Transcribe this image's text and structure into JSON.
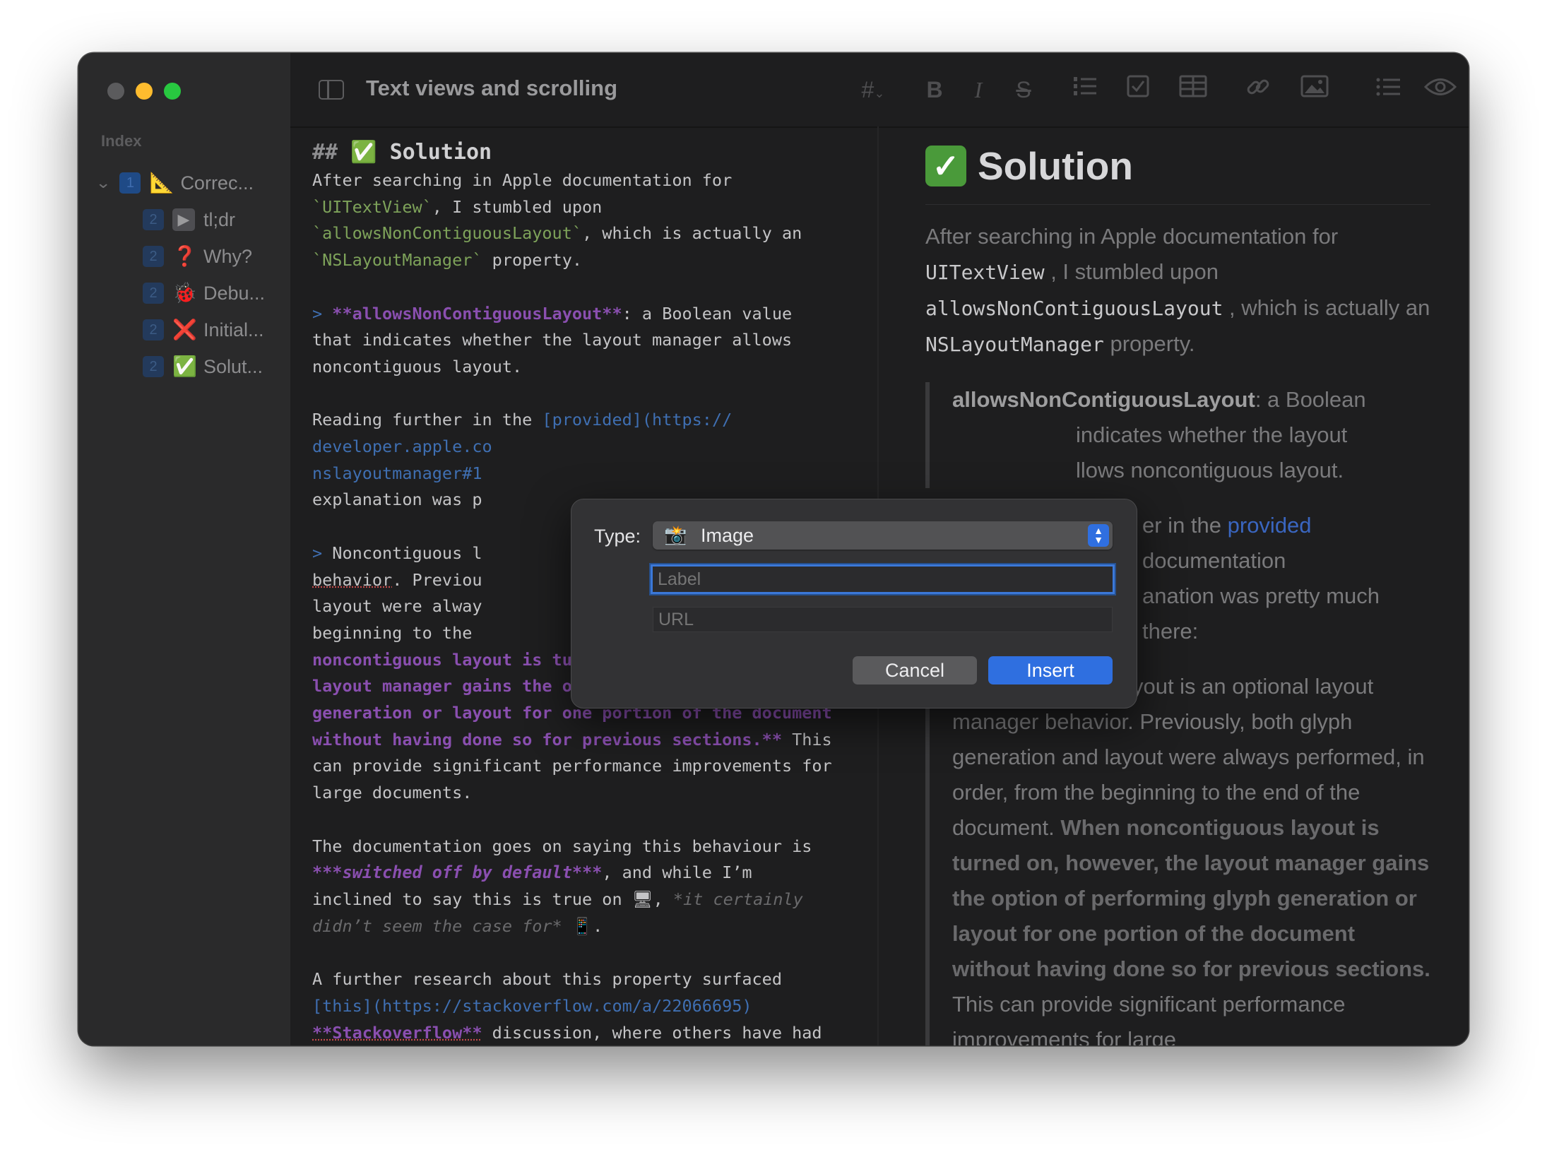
{
  "window": {
    "title": "Text views and scrolling"
  },
  "sidebar": {
    "index_label": "Index",
    "items": [
      {
        "level": "1",
        "icon": "triangle-ruler-icon",
        "glyph": "📐",
        "label": "Correc..."
      },
      {
        "level": "2",
        "icon": "play-icon",
        "glyph": "▶",
        "label": "tl;dr"
      },
      {
        "level": "2",
        "icon": "question-icon",
        "glyph": "❓",
        "label": "Why?"
      },
      {
        "level": "2",
        "icon": "bug-icon",
        "glyph": "🐞",
        "label": "Debu..."
      },
      {
        "level": "2",
        "icon": "cross-mark-icon",
        "glyph": "❌",
        "label": "Initial..."
      },
      {
        "level": "2",
        "icon": "check-mark-icon",
        "glyph": "✅",
        "label": "Solut..."
      }
    ]
  },
  "toolbar": {
    "heading": "#",
    "bold": "B",
    "italic": "I",
    "strike": "S"
  },
  "editor": {
    "heading_marker": "## ",
    "heading_check": "✅",
    "heading_text": " Solution",
    "p1_a": "After searching in Apple documentation for\n",
    "p1_code1": "`UITextView`",
    "p1_b": ", I stumbled upon\n",
    "p1_code2": "`allowsNonContiguousLayout`",
    "p1_c": ", which is actually an\n",
    "p1_code3": "`NSLayoutManager`",
    "p1_d": " property.",
    "q1_marker": "> ",
    "q1_bold": "**allowsNonContiguousLayout**",
    "q1_rest": ": a Boolean value\nthat indicates whether the layout manager allows\nnoncontiguous layout.",
    "p2_a": "Reading further in the ",
    "p2_link": "[provided](https://\ndeveloper.apple.co",
    "p2_link2": "nslayoutmanager#1",
    "p2_b": "explanation was p",
    "q2_marker": "> ",
    "q2_a": "Noncontiguous l",
    "q2_spell": "behavior",
    "q2_b": ". Previou\nlayout were alway\nbeginning to the",
    "q2_bold": "noncontiguous layout is turned on, however, the\nlayout manager gains the option of performing glyph\ngeneration or layout for one portion of the document\nwithout having done so for previous sections.**",
    "q2_c": " This\ncan provide significant performance improvements for\nlarge documents.",
    "p3_a": "The documentation goes on saying this behaviour is\n",
    "p3_em": "***switched off by default***",
    "p3_b": ", and while I’m\ninclined to say this is true on ",
    "p3_mac": "🖥",
    "p3_c": ", ",
    "p3_it": "*it certainly\ndidn’t seem the case for*",
    "p3_phone": " 📱",
    "p3_d": ".",
    "p4_a": "A further research about this property surfaced\n",
    "p4_link": "[this](https://stackoverflow.com/a/22066695)",
    "p4_bold": "**Stackoverflow**",
    "p4_b": " discussion, where others have had"
  },
  "preview": {
    "heading_check": "✓",
    "heading": "Solution",
    "p1_a": "After searching in Apple documentation for ",
    "p1_code1": "UITextView",
    "p1_b": " , I stumbled upon ",
    "p1_code2": "allowsNonContiguousLayout",
    "p1_c": " , which is actually an ",
    "p1_code3": "NSLayoutManager",
    "p1_d": "  property.",
    "q1_bold": "allowsNonContiguousLayout",
    "q1_a": ": a Boolean",
    "q1_b": "indicates whether the layout",
    "q1_c": "llows noncontiguous layout.",
    "p2_a": "er in the ",
    "p2_link": "provided",
    "p2_b": " documentation",
    "p2_c": "anation was pretty much there:",
    "q2_a": "uous layout is an optional layout manager behavior. Previously, both glyph generation and layout were always performed, in order, from the beginning to the end of the document. ",
    "q2_bold": "When noncontiguous layout is turned on, however, the layout manager gains the option of performing glyph generation or layout for one portion of the document without having done so for previous sections.",
    "q2_b": " This can provide significant performance improvements for large"
  },
  "dialog": {
    "type_label": "Type:",
    "type_value": "Image",
    "type_icon": "📸",
    "label_placeholder": "Label",
    "url_placeholder": "URL",
    "cancel": "Cancel",
    "insert": "Insert"
  },
  "colors": {
    "accent": "#2f6fe0",
    "code": "#7ea35a",
    "emphasis": "#8a4fb0",
    "link": "#3f6fb2"
  }
}
